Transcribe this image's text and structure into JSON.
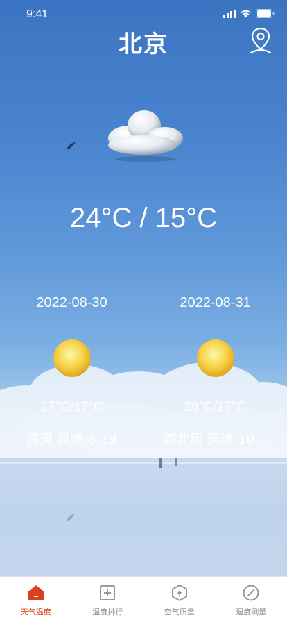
{
  "status_bar": {
    "time": "9:41"
  },
  "header": {
    "title": "北京",
    "location_icon": "location-pin-icon"
  },
  "current": {
    "temperature": "24°C / 15°C",
    "icon": "cloud-icon"
  },
  "forecast": [
    {
      "date": "2022-08-30",
      "temperature": "27°C/17°C",
      "wind": "西风 风速:6.19",
      "icon": "sun-icon"
    },
    {
      "date": "2022-08-31",
      "temperature": "29°C/17°C",
      "wind": "西北风 风速:10...",
      "icon": "sun-icon"
    }
  ],
  "tabs": [
    {
      "label": "天气温度",
      "icon": "house-icon",
      "active": true
    },
    {
      "label": "温度排行",
      "icon": "plus-square-icon",
      "active": false
    },
    {
      "label": "空气质量",
      "icon": "bolt-hexagon-icon",
      "active": false
    },
    {
      "label": "湿度测量",
      "icon": "compass-icon",
      "active": false
    }
  ],
  "colors": {
    "accent": "#d9401f",
    "inactive": "#8c8c8c",
    "sky_top": "#3b74c2"
  }
}
